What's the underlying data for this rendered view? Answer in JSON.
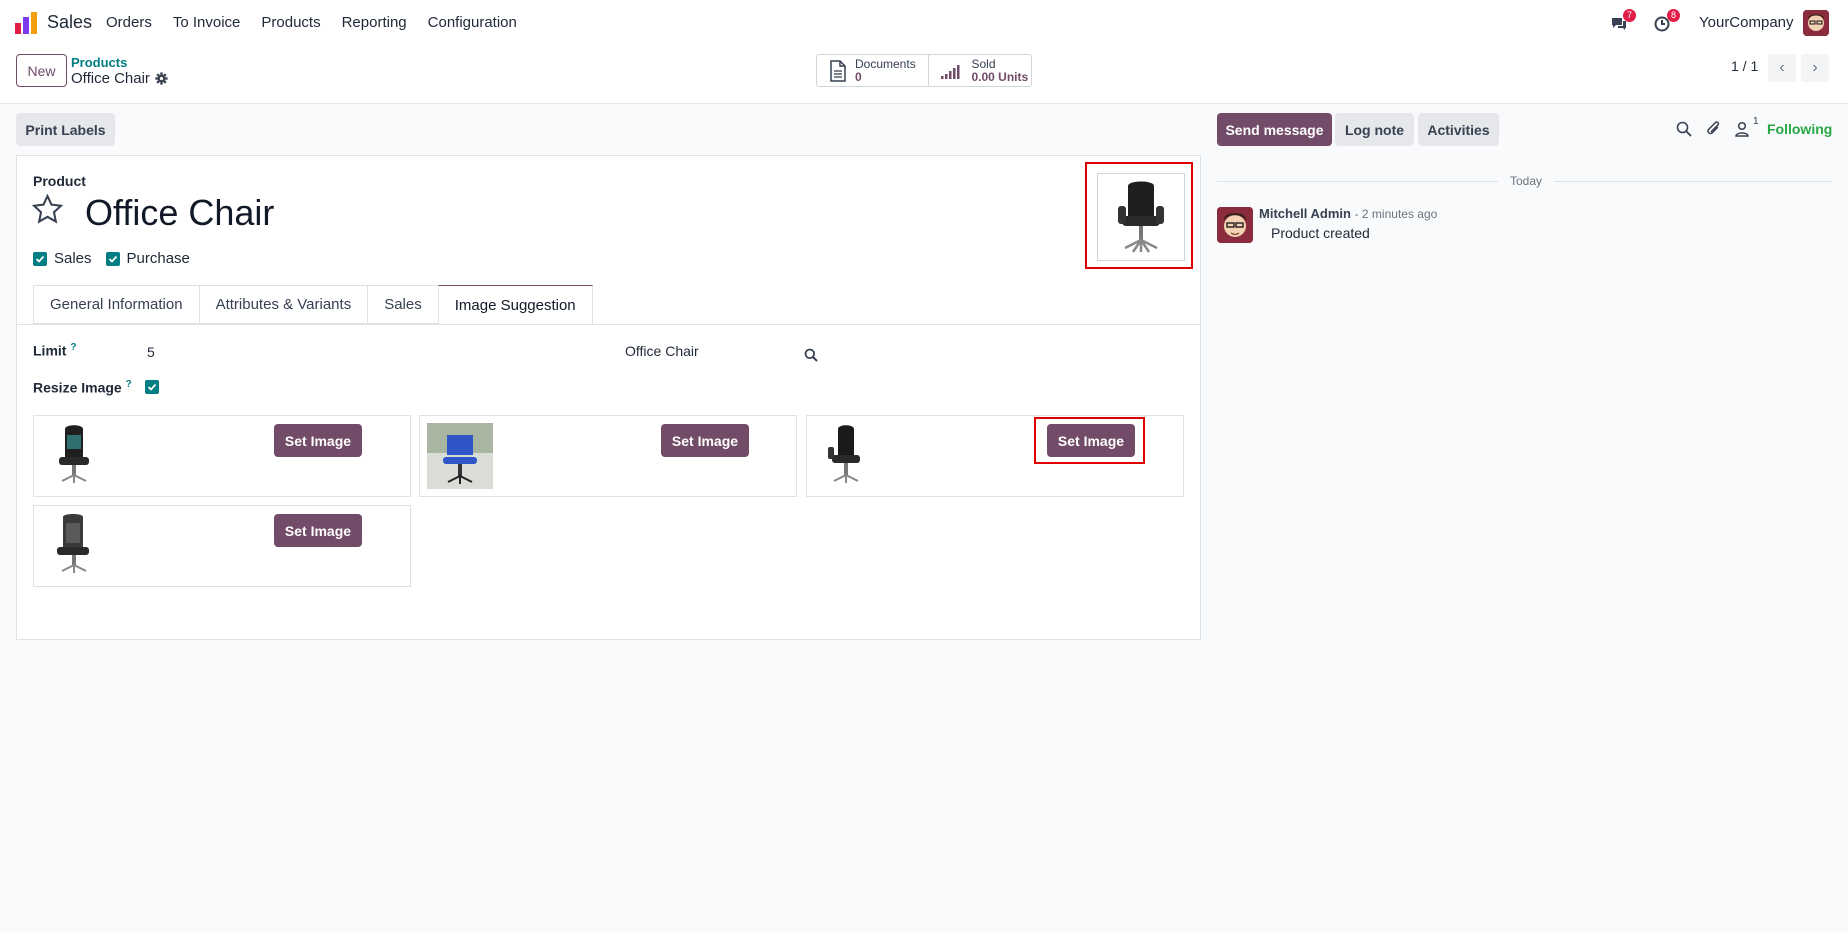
{
  "navbar": {
    "app_name": "Sales",
    "menu": [
      "Orders",
      "To Invoice",
      "Products",
      "Reporting",
      "Configuration"
    ],
    "messages_badge": "7",
    "activities_badge": "8",
    "company": "YourCompany"
  },
  "control_panel": {
    "new_label": "New",
    "breadcrumb_parent": "Products",
    "breadcrumb_current": "Office Chair",
    "documents_title": "Documents",
    "documents_value": "0",
    "sold_title": "Sold",
    "sold_value": "0.00 Units",
    "pager": "1 / 1"
  },
  "form": {
    "print_labels": "Print Labels",
    "product_label": "Product",
    "product_name": "Office Chair",
    "sales_label": "Sales",
    "purchase_label": "Purchase",
    "tabs": [
      "General Information",
      "Attributes & Variants",
      "Sales",
      "Image Suggestion"
    ],
    "active_tab": "Image Suggestion",
    "limit_label": "Limit",
    "help_mark": "?",
    "limit_value": "5",
    "query_value": "Office Chair",
    "resize_label": "Resize Image",
    "set_image_label": "Set Image"
  },
  "chatter": {
    "send_message": "Send message",
    "log_note": "Log note",
    "activities": "Activities",
    "followers_count": "1",
    "following": "Following",
    "date_separator": "Today",
    "message_author": "Mitchell Admin",
    "message_time": "- 2 minutes ago",
    "message_body": "Product created"
  },
  "colors": {
    "brand": "#714b67",
    "teal": "#017e84",
    "highlight": "#e00000",
    "following": "#28a745"
  }
}
